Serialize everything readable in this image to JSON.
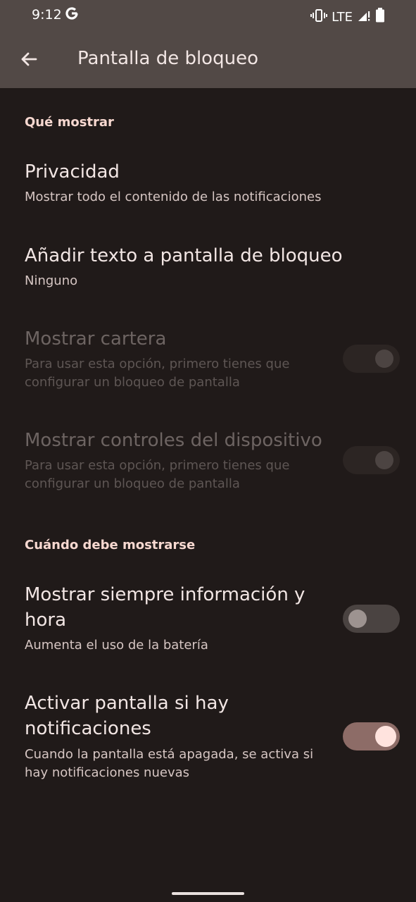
{
  "status_bar": {
    "time": "9:12",
    "network": "LTE"
  },
  "app_bar": {
    "title": "Pantalla de bloqueo",
    "back_icon": "arrow-back-icon"
  },
  "sections": [
    {
      "header": "Qué mostrar",
      "items": [
        {
          "title": "Privacidad",
          "subtitle": "Mostrar todo el contenido de las notificaciones"
        },
        {
          "title": "Añadir texto a pantalla de bloqueo",
          "subtitle": "Ninguno"
        },
        {
          "title": "Mostrar cartera",
          "subtitle_line1": "Para usar esta opción, primero tienes que",
          "subtitle_line2": "configurar un bloqueo de pantalla",
          "enabled": false,
          "toggle": "off"
        },
        {
          "title": "Mostrar controles del dispositivo",
          "subtitle_line1": "Para usar esta opción, primero tienes que",
          "subtitle_line2": "configurar un bloqueo de pantalla",
          "enabled": false,
          "toggle": "off"
        }
      ]
    },
    {
      "header": "Cuándo debe mostrarse",
      "items": [
        {
          "title_line1": "Mostrar siempre información y",
          "title_line2": "hora",
          "subtitle": "Aumenta el uso de la batería",
          "toggle": "off"
        },
        {
          "title_line1": "Activar pantalla si hay",
          "title_line2": "notificaciones",
          "subtitle_line1": "Cuando la pantalla está apagada, se activa si",
          "subtitle_line2": "hay notificaciones nuevas",
          "toggle": "on"
        }
      ]
    }
  ],
  "colors": {
    "background": "#201a19",
    "app_bar": "#524946",
    "accent": "#f7d8d0",
    "toggle_on_track": "#8d6c67",
    "toggle_on_knob": "#ffe3de"
  }
}
